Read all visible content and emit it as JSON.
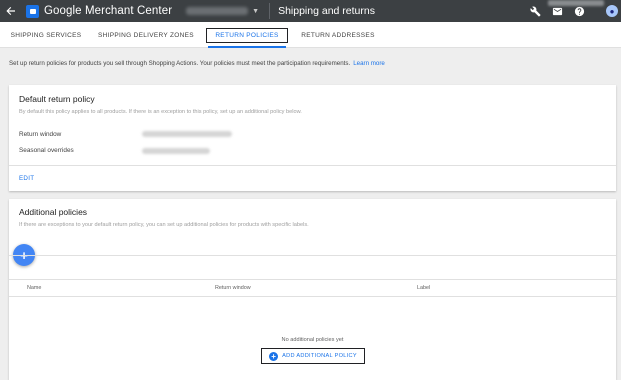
{
  "header": {
    "back_icon": "arrow-back-icon",
    "app_title": "Google Merchant Center",
    "page_title": "Shipping and returns",
    "icons": [
      "wrench-icon",
      "mail-icon",
      "help-icon"
    ],
    "colors": {
      "bar": "#3c4043",
      "accent": "#1a73e8"
    }
  },
  "tabs": [
    {
      "label": "SHIPPING SERVICES",
      "active": false
    },
    {
      "label": "SHIPPING DELIVERY ZONES",
      "active": false
    },
    {
      "label": "RETURN POLICIES",
      "active": true
    },
    {
      "label": "RETURN ADDRESSES",
      "active": false
    }
  ],
  "intro": {
    "text": "Set up return policies for products you sell through Shopping Actions. Your policies must meet the participation requirements.",
    "link": "Learn more"
  },
  "default_policy": {
    "title": "Default return policy",
    "description": "By default this policy applies to all products. If there is an exception to this policy, set up an additional policy below.",
    "rows": [
      {
        "label": "Return window"
      },
      {
        "label": "Seasonal overrides"
      }
    ],
    "edit_label": "EDIT"
  },
  "additional_policies": {
    "title": "Additional policies",
    "description": "If there are exceptions to your default return policy, you can set up additional policies for products with specific labels.",
    "columns": [
      "Name",
      "Return window",
      "Label"
    ],
    "empty_text": "No additional policies yet",
    "add_label": "ADD ADDITIONAL POLICY"
  }
}
